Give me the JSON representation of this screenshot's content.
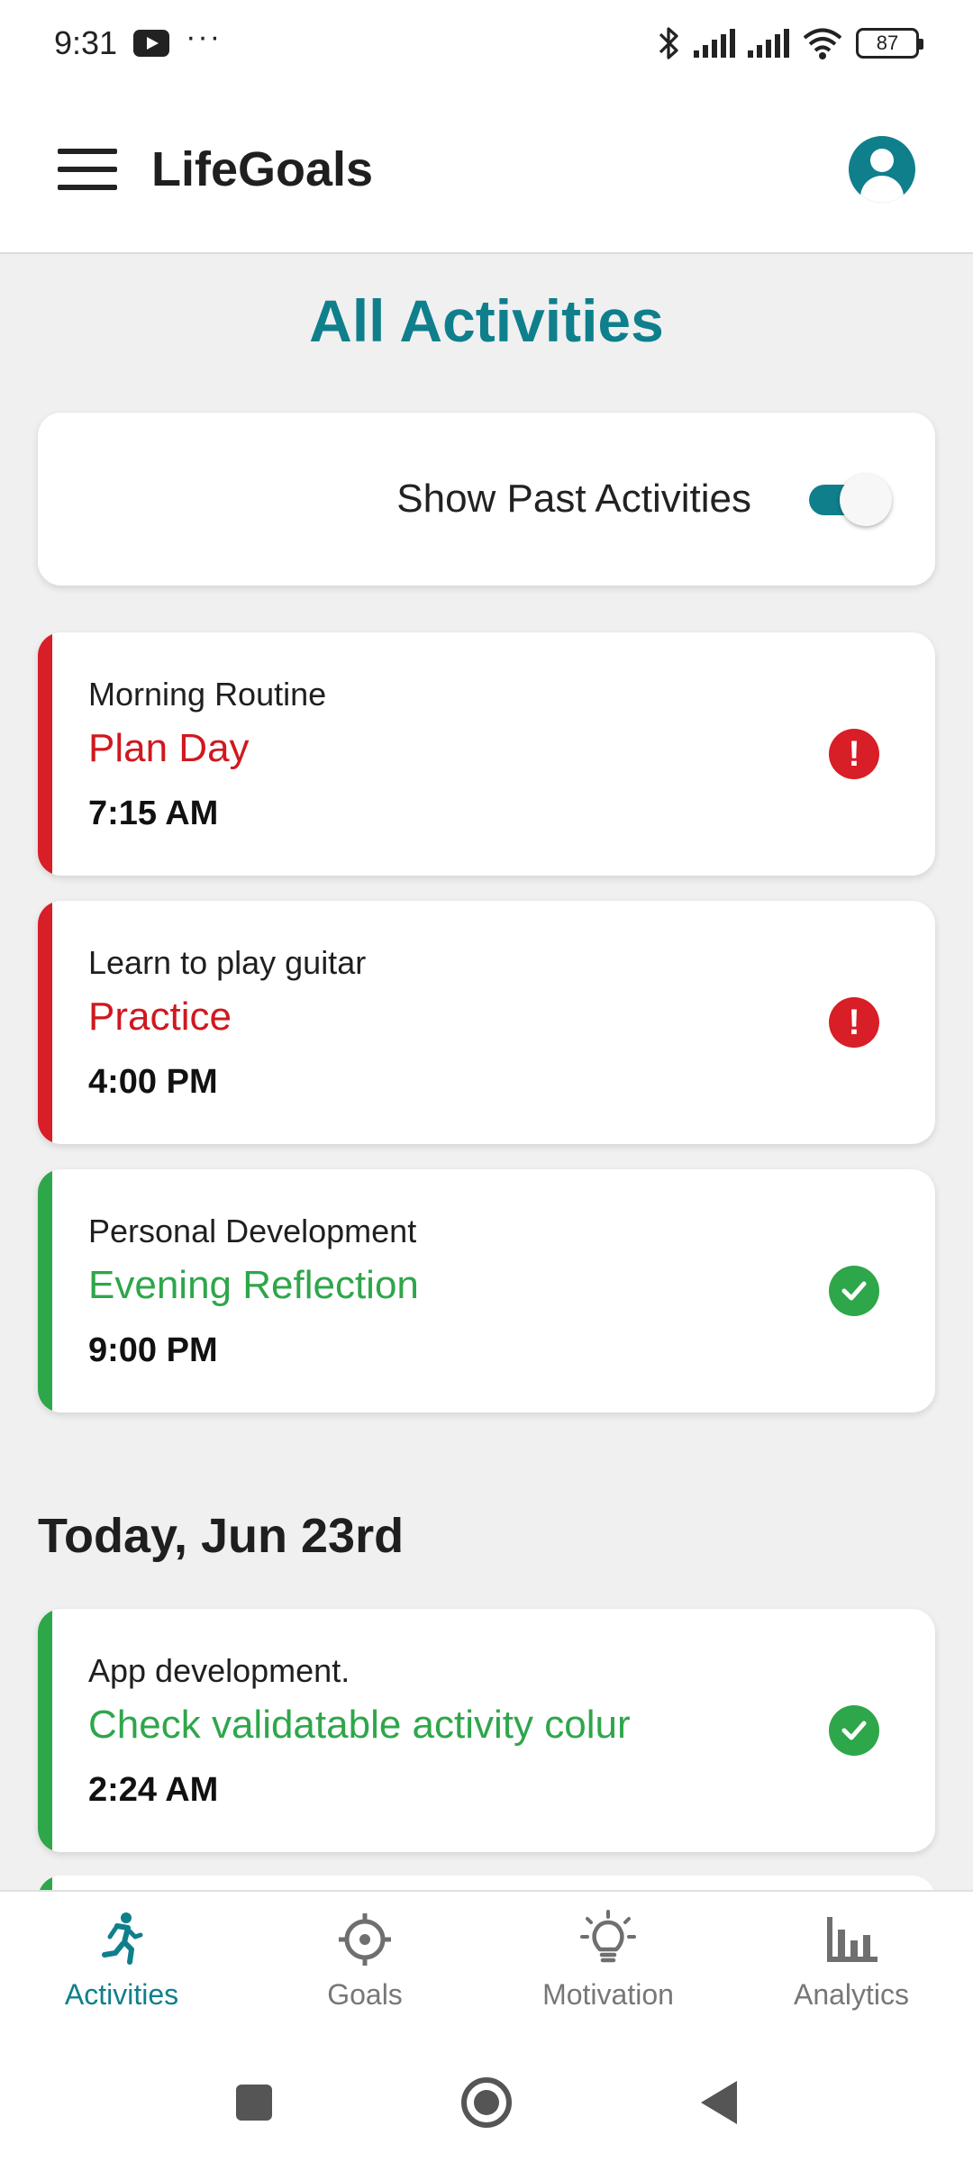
{
  "status_bar": {
    "time": "9:31",
    "more": "···",
    "battery": "87"
  },
  "app_bar": {
    "title": "LifeGoals"
  },
  "page": {
    "title": "All Activities"
  },
  "filter": {
    "label": "Show Past Activities",
    "enabled": true
  },
  "past_activities": [
    {
      "goal": "Morning Routine",
      "name": "Plan Day",
      "time": "7:15 AM",
      "status": "overdue",
      "status_icon": "exclamation-icon",
      "color": "#d81e26"
    },
    {
      "goal": "Learn to play guitar",
      "name": "Practice",
      "time": "4:00 PM",
      "status": "overdue",
      "status_icon": "exclamation-icon",
      "color": "#d81e26"
    },
    {
      "goal": "Personal Development",
      "name": "Evening Reflection",
      "time": "9:00 PM",
      "status": "done",
      "status_icon": "check-icon",
      "color": "#2ea64a"
    }
  ],
  "today": {
    "heading": "Today, Jun 23rd",
    "activities": [
      {
        "goal": "App development.",
        "name": "Check validatable activity colur",
        "time": "2:24 AM",
        "status": "done",
        "status_icon": "check-icon",
        "color": "#2ea64a"
      }
    ]
  },
  "bottom_nav": [
    {
      "label": "Activities",
      "icon": "running-person-icon",
      "active": true
    },
    {
      "label": "Goals",
      "icon": "crosshair-icon",
      "active": false
    },
    {
      "label": "Motivation",
      "icon": "lightbulb-icon",
      "active": false
    },
    {
      "label": "Analytics",
      "icon": "bar-chart-icon",
      "active": false
    }
  ],
  "colors": {
    "accent": "#0f7f8c",
    "overdue": "#d81e26",
    "done": "#2ea64a"
  }
}
